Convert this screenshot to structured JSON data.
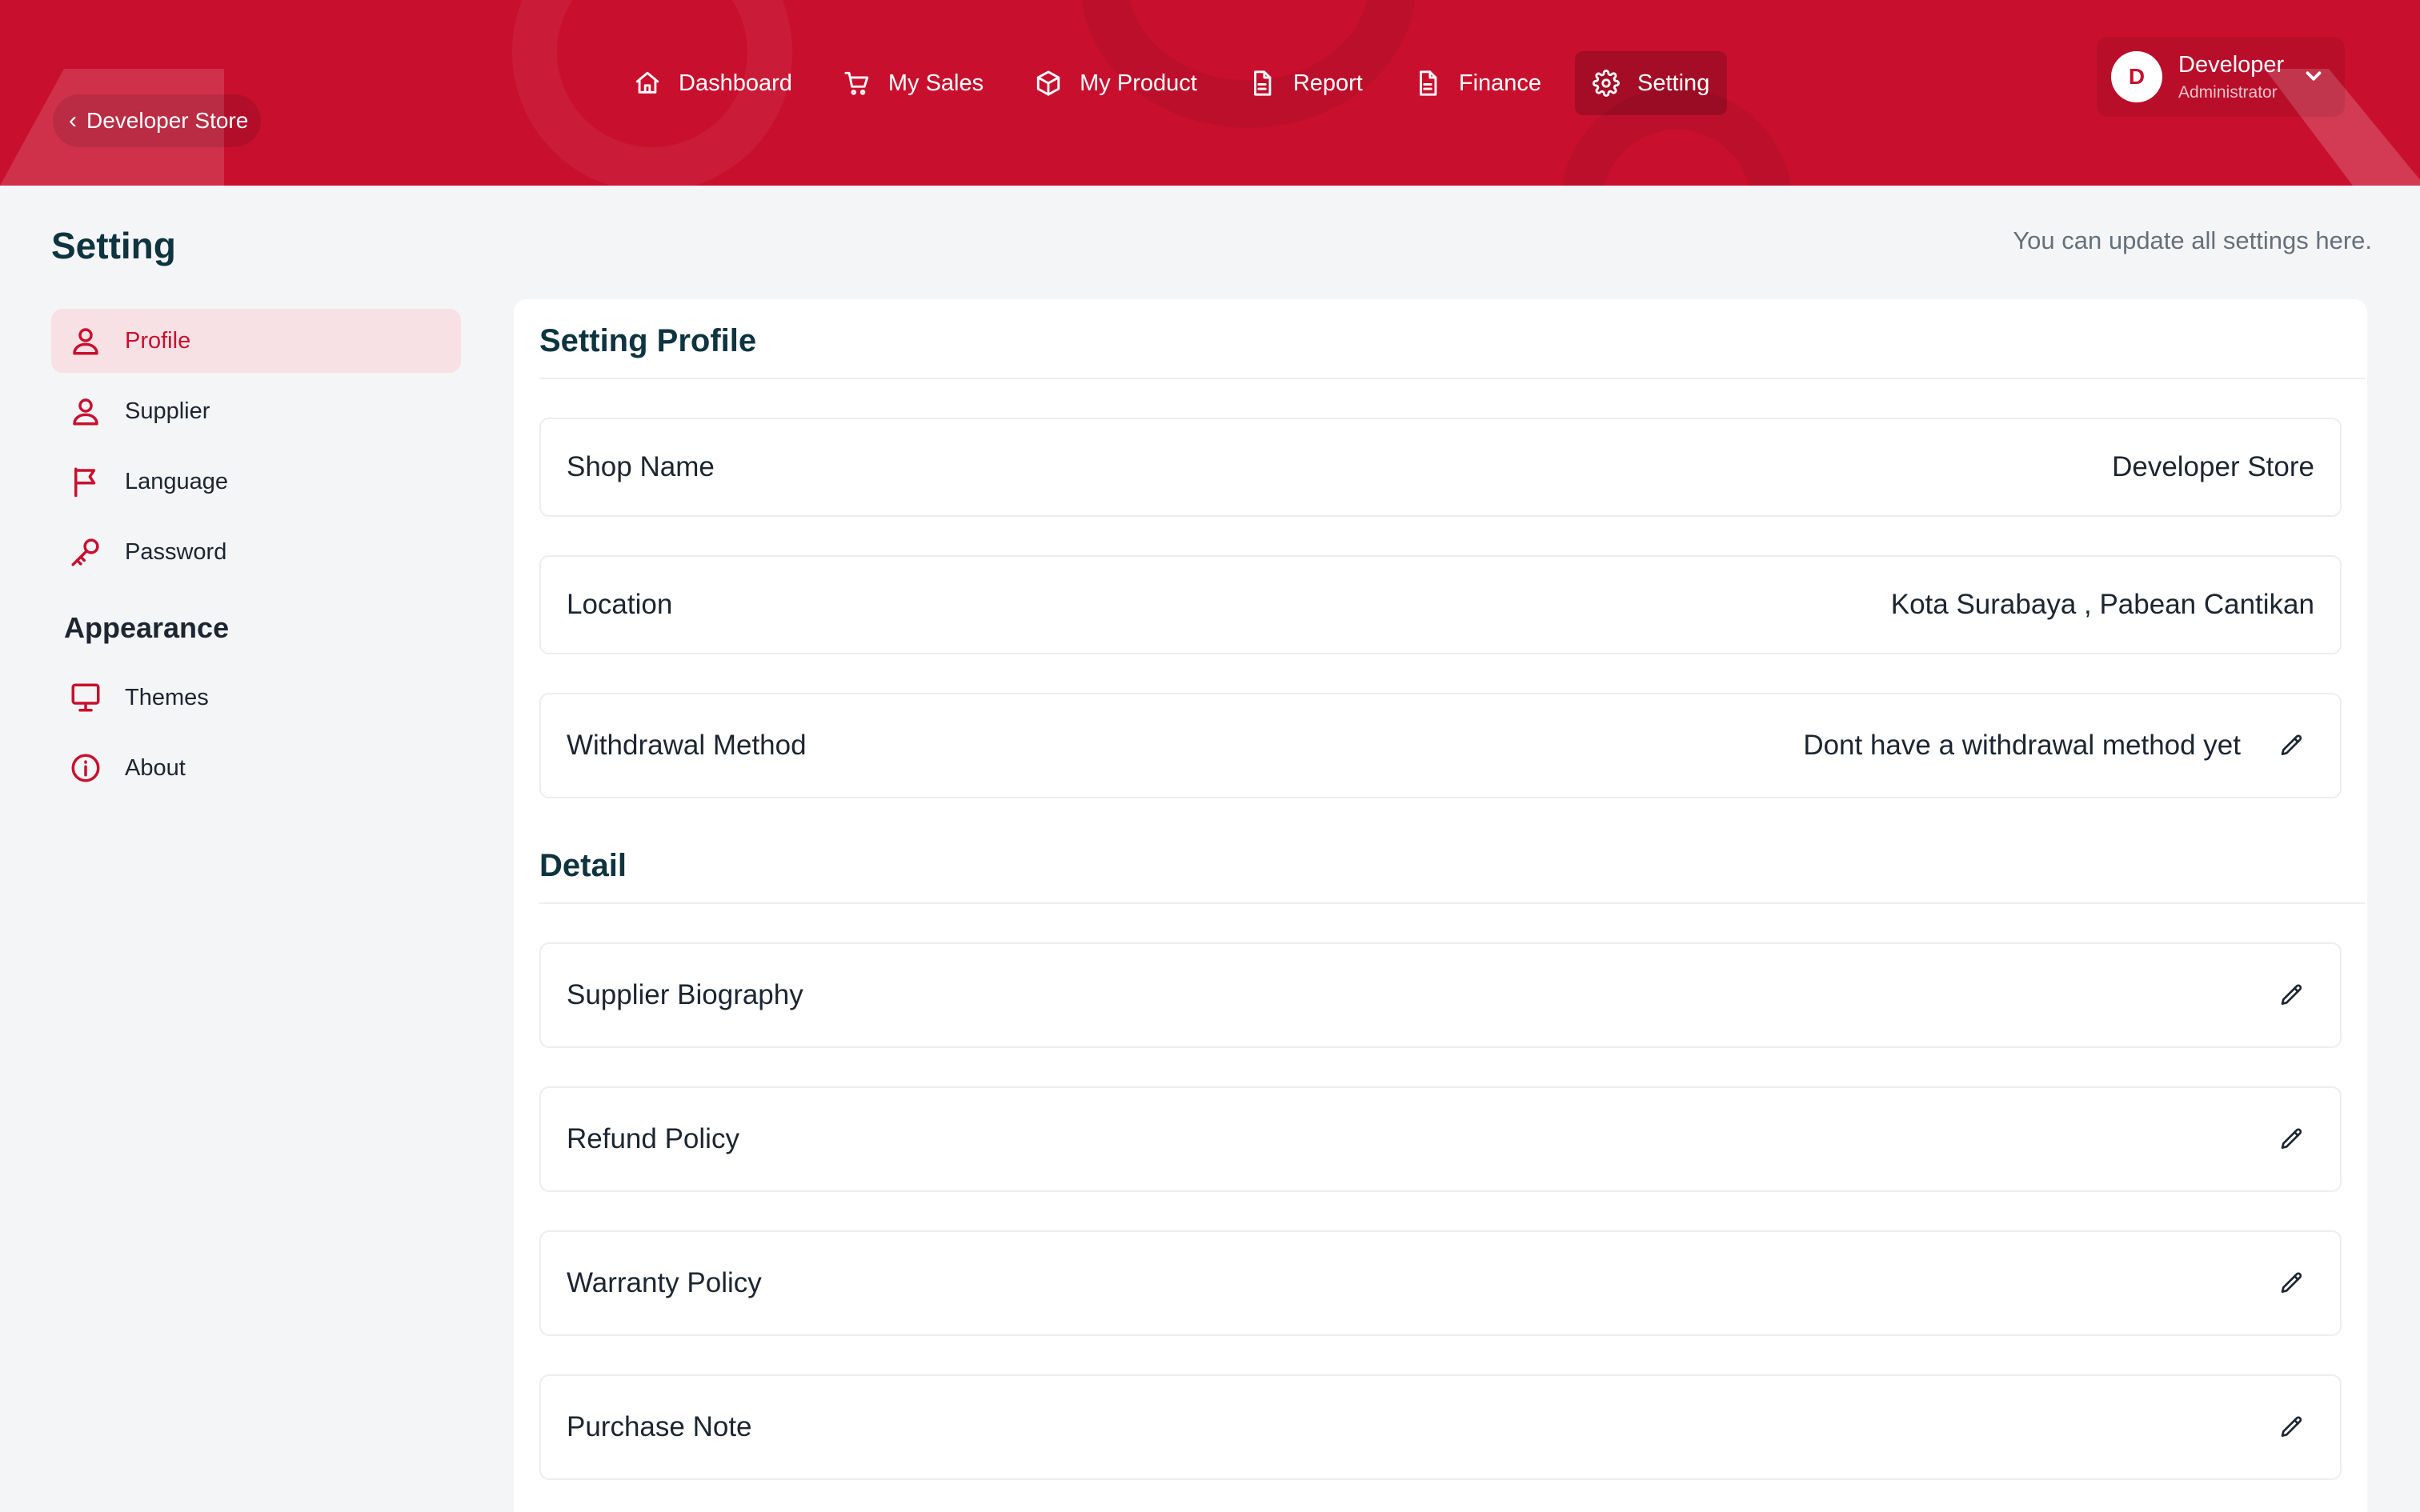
{
  "header": {
    "store_link": "Developer Store",
    "nav": [
      {
        "label": "Dashboard",
        "icon": "home-icon"
      },
      {
        "label": "My Sales",
        "icon": "cart-icon"
      },
      {
        "label": "My Product",
        "icon": "box-icon"
      },
      {
        "label": "Report",
        "icon": "document-icon"
      },
      {
        "label": "Finance",
        "icon": "document-icon"
      },
      {
        "label": "Setting",
        "icon": "gear-icon",
        "active": true
      }
    ],
    "user": {
      "initial": "D",
      "name": "Developer",
      "role": "Administrator"
    }
  },
  "page": {
    "title": "Setting",
    "subtitle": "You can update all settings here."
  },
  "sidebar": {
    "items": [
      {
        "label": "Profile",
        "icon": "user-icon",
        "active": true
      },
      {
        "label": "Supplier",
        "icon": "user-icon"
      },
      {
        "label": "Language",
        "icon": "flag-icon"
      },
      {
        "label": "Password",
        "icon": "key-icon"
      }
    ],
    "appearance_heading": "Appearance",
    "appearance_items": [
      {
        "label": "Themes",
        "icon": "monitor-icon"
      },
      {
        "label": "About",
        "icon": "info-icon"
      }
    ]
  },
  "profile": {
    "heading": "Setting Profile",
    "fields": [
      {
        "label": "Shop Name",
        "value": "Developer Store"
      },
      {
        "label": "Location",
        "value": "Kota Surabaya , Pabean Cantikan"
      },
      {
        "label": "Withdrawal Method",
        "value": "Dont have a withdrawal method yet",
        "editable": true
      }
    ]
  },
  "detail": {
    "heading": "Detail",
    "fields": [
      {
        "label": "Supplier Biography"
      },
      {
        "label": "Refund Policy"
      },
      {
        "label": "Warranty Policy"
      },
      {
        "label": "Purchase Note"
      }
    ]
  },
  "colors": {
    "brand": "#c8102e",
    "heading": "#0e3440",
    "active_bg": "#f7e1e5"
  }
}
